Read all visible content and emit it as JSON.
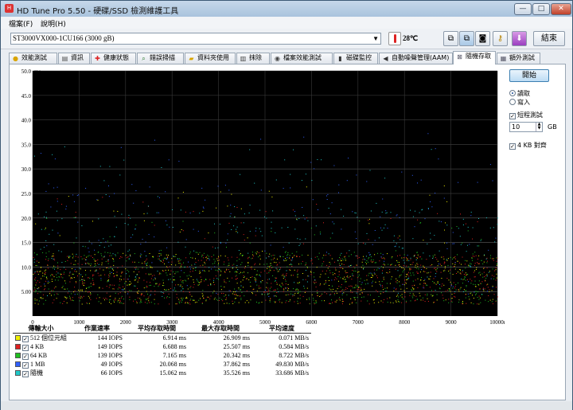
{
  "app": {
    "title": "HD Tune Pro 5.50 - 硬碟/SSD 檢測維護工具",
    "icon": "app-icon"
  },
  "window_buttons": {
    "minimize": "—",
    "maximize": "□",
    "close": "✕"
  },
  "menu": [
    "檔案(F)",
    "說明(H)"
  ],
  "toolbar": {
    "drive": "ST3000VX000-1CU166 (3000 gB)",
    "temperature": "28℃",
    "exit_label": "結束",
    "icons": [
      "copy-text-icon",
      "copy-image-icon",
      "camera-icon",
      "keys-icon",
      "download-icon"
    ]
  },
  "tabs": [
    {
      "label": "效能測試",
      "icon": "bulb-icon"
    },
    {
      "label": "資訊",
      "icon": "doc-icon"
    },
    {
      "label": "健康狀態",
      "icon": "health-cross-icon"
    },
    {
      "label": "錯誤掃描",
      "icon": "magnifier-icon"
    },
    {
      "label": "資料夾使用",
      "icon": "folder-icon"
    },
    {
      "label": "抹除",
      "icon": "trash-icon"
    },
    {
      "label": "檔案效能測試",
      "icon": "file-benchmark-icon"
    },
    {
      "label": "磁碟監控",
      "icon": "monitor-icon"
    },
    {
      "label": "自動噪聲管理(AAM)",
      "icon": "speaker-icon"
    },
    {
      "label": "隨機存取",
      "icon": "random-access-icon"
    },
    {
      "label": "額外測試",
      "icon": "extra-tests-icon"
    }
  ],
  "active_tab": 9,
  "side": {
    "start_label": "開始",
    "read_label": "讀取",
    "write_label": "寫入",
    "short_test_label": "短程測試",
    "size_value": "10",
    "size_unit": "GB",
    "align_label": "4 KB 對齊"
  },
  "chart_data": {
    "type": "scatter",
    "ylabel": "ms",
    "ylim": [
      0,
      50
    ],
    "yticks": [
      "5.00",
      "10.0",
      "15.0",
      "20.0",
      "25.0",
      "30.0",
      "35.0",
      "40.0",
      "45.0",
      "50.0"
    ],
    "xlim": [
      0,
      10000
    ],
    "xticks": [
      "0",
      "1000",
      "2000",
      "3000",
      "4000",
      "5000",
      "6000",
      "7000",
      "8000",
      "9000",
      "10000mB"
    ],
    "grid": true,
    "series": [
      {
        "name": "512 個位元組",
        "color": "#f0f000"
      },
      {
        "name": "4 KB",
        "color": "#e02020"
      },
      {
        "name": "64 KB",
        "color": "#20c020"
      },
      {
        "name": "1 MB",
        "color": "#3060ff"
      },
      {
        "name": "隨機",
        "color": "#20c8c8"
      }
    ]
  },
  "results": {
    "headers": [
      "傳輸大小",
      "作業速率",
      "平均存取時間",
      "最大存取時間",
      "平均速度"
    ],
    "rows": [
      {
        "size": "512 個位元組",
        "color": "#f0f000",
        "rate": "144 IOPS",
        "avg": "6.914 ms",
        "max": "26.909 ms",
        "speed": "0.071 MB/s"
      },
      {
        "size": "4 KB",
        "color": "#e02020",
        "rate": "149 IOPS",
        "avg": "6.688 ms",
        "max": "25.507 ms",
        "speed": "0.584 MB/s"
      },
      {
        "size": "64 KB",
        "color": "#20c020",
        "rate": "139 IOPS",
        "avg": "7.165 ms",
        "max": "20.342 ms",
        "speed": "8.722 MB/s"
      },
      {
        "size": "1 MB",
        "color": "#3060ff",
        "rate": "49 IOPS",
        "avg": "20.068 ms",
        "max": "37.862 ms",
        "speed": "49.830 MB/s"
      },
      {
        "size": "隨機",
        "color": "#20c8c8",
        "rate": "66 IOPS",
        "avg": "15.062 ms",
        "max": "35.526 ms",
        "speed": "33.686 MB/s"
      }
    ]
  }
}
